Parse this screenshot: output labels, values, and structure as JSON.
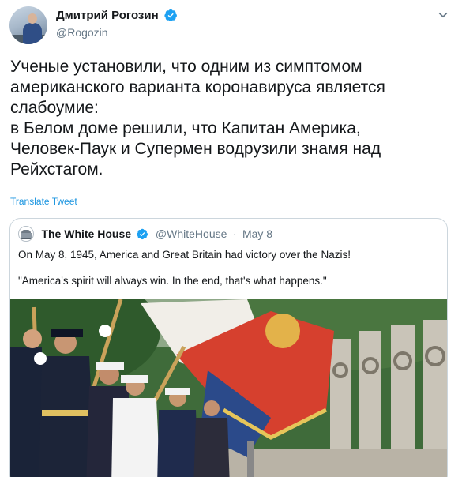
{
  "tweet": {
    "author": {
      "display_name": "Дмитрий Рогозин",
      "handle": "@Rogozin",
      "verified": true
    },
    "text": "Ученые установили, что одним из симптомом\nамериканского варианта коронавируса является\nслабоумие:\nв Белом доме решили, что Капитан Америка,\nЧеловек-Паук и Супермен водрузили знамя над\nРейхстагом.",
    "translate_label": "Translate Tweet",
    "menu_icon": "caret-down-icon"
  },
  "quoted_tweet": {
    "author": {
      "display_name": "The White House",
      "handle": "@WhiteHouse",
      "verified": true
    },
    "separator": "·",
    "date": "May 8",
    "line1": "On May 8, 1945, America and Great Britain had victory over the Nazis!",
    "line2": "\"America's spirit will always win. In the end, that's what happens.\"",
    "media": {
      "description_icon": "photo-honor-guard-flags"
    }
  },
  "colors": {
    "text": "#14171a",
    "secondary": "#657786",
    "link": "#1b95e0",
    "verified": "#1da1f2",
    "border": "#ccd6dd"
  }
}
